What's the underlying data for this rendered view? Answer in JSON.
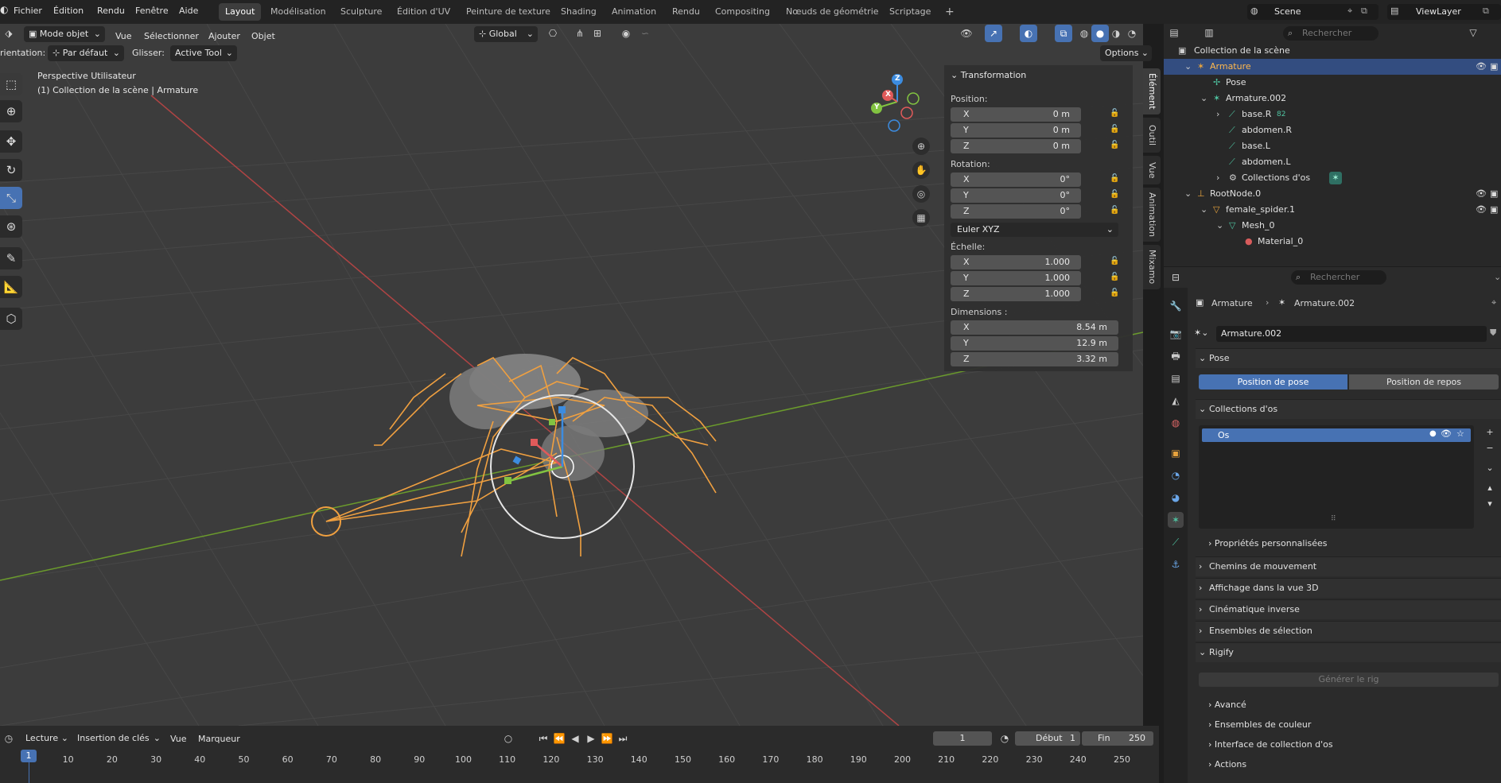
{
  "topbar": {
    "menus": [
      "Fichier",
      "Édition",
      "Rendu",
      "Fenêtre",
      "Aide"
    ],
    "workspaces": [
      "Layout",
      "Modélisation",
      "Sculpture",
      "Édition d'UV",
      "Peinture de texture",
      "Shading",
      "Animation",
      "Rendu",
      "Compositing",
      "Nœuds de géométrie",
      "Scriptage"
    ],
    "active_workspace": "Layout",
    "add_workspace": "+",
    "scene": "Scene",
    "view_layer": "ViewLayer"
  },
  "viewport_header": {
    "mode": "Mode objet",
    "menus": [
      "Vue",
      "Sélectionner",
      "Ajouter",
      "Objet"
    ],
    "transform_orientation": "Global",
    "options": "Options",
    "orientation_label": "rientation:",
    "orientation_value": "Par défaut",
    "drag_label": "Glisser:",
    "drag_value": "Active Tool"
  },
  "viewport": {
    "view_name": "Perspective Utilisateur",
    "collection_info": "(1) Collection de la scène | Armature",
    "gizmo": {
      "x": "X",
      "y": "Y",
      "z": "Z"
    }
  },
  "npanel": {
    "section": "Transformation",
    "position_label": "Position:",
    "position": [
      {
        "axis": "X",
        "value": "0 m"
      },
      {
        "axis": "Y",
        "value": "0 m"
      },
      {
        "axis": "Z",
        "value": "0 m"
      }
    ],
    "rotation_label": "Rotation:",
    "rotation": [
      {
        "axis": "X",
        "value": "0°"
      },
      {
        "axis": "Y",
        "value": "0°"
      },
      {
        "axis": "Z",
        "value": "0°"
      }
    ],
    "rotation_mode": "Euler XYZ",
    "scale_label": "Échelle:",
    "scale": [
      {
        "axis": "X",
        "value": "1.000"
      },
      {
        "axis": "Y",
        "value": "1.000"
      },
      {
        "axis": "Z",
        "value": "1.000"
      }
    ],
    "dimensions_label": "Dimensions :",
    "dimensions": [
      {
        "axis": "X",
        "value": "8.54 m"
      },
      {
        "axis": "Y",
        "value": "12.9 m"
      },
      {
        "axis": "Z",
        "value": "3.32 m"
      }
    ],
    "tabs": [
      "Élément",
      "Outil",
      "Vue",
      "Animation",
      "Mixamo"
    ]
  },
  "outliner": {
    "search_placeholder": "Rechercher",
    "root": "Collection de la scène",
    "items": [
      {
        "label": "Armature",
        "icon": "armature-icon",
        "color": "#e8a33d"
      },
      {
        "label": "Pose",
        "icon": "pose-icon",
        "color": "#4fc3a1"
      },
      {
        "label": "Armature.002",
        "icon": "armature-data-icon",
        "color": "#4fc3a1"
      },
      {
        "label": "base.R",
        "icon": "bone-icon",
        "color": "#4fc3a1",
        "badge": "82"
      },
      {
        "label": "abdomen.R",
        "icon": "bone-icon",
        "color": "#4fc3a1"
      },
      {
        "label": "base.L",
        "icon": "bone-icon",
        "color": "#4fc3a1"
      },
      {
        "label": "abdomen.L",
        "icon": "bone-icon",
        "color": "#4fc3a1"
      },
      {
        "label": "Collections d'os",
        "icon": "bone-collections-icon",
        "color": "#cfcfcf"
      },
      {
        "label": "RootNode.0",
        "icon": "empty-icon",
        "color": "#e8a33d"
      },
      {
        "label": "female_spider.1",
        "icon": "mesh-object-icon",
        "color": "#e8a33d"
      },
      {
        "label": "Mesh_0",
        "icon": "mesh-data-icon",
        "color": "#4fc3a1"
      },
      {
        "label": "Material_0",
        "icon": "material-icon",
        "color": "#d85c5c"
      }
    ]
  },
  "properties": {
    "search_placeholder": "Rechercher",
    "breadcrumb": [
      "Armature",
      "Armature.002"
    ],
    "datablock": "Armature.002",
    "pose_section": "Pose",
    "pose_position": "Position de pose",
    "rest_position": "Position de repos",
    "bone_collections_section": "Collections d'os",
    "bone_collection": "Os",
    "custom_props": "Propriétés personnalisées",
    "sections": [
      "Chemins de mouvement",
      "Affichage dans la vue 3D",
      "Cinématique inverse",
      "Ensembles de sélection"
    ],
    "rigify_section": "Rigify",
    "generate_rig": "Générer le rig",
    "rigify_subs": [
      "Avancé",
      "Ensembles de couleur",
      "Interface de collection d'os",
      "Actions"
    ]
  },
  "timeline": {
    "menus": [
      "Lecture",
      "Insertion de clés",
      "Vue",
      "Marqueur"
    ],
    "current_frame": "1",
    "start_label": "Début",
    "start": "1",
    "end_label": "Fin",
    "end": "250",
    "ticks": [
      "1",
      "10",
      "20",
      "30",
      "40",
      "50",
      "60",
      "70",
      "80",
      "90",
      "100",
      "110",
      "120",
      "130",
      "140",
      "150",
      "160",
      "170",
      "180",
      "190",
      "200",
      "210",
      "220",
      "230",
      "240",
      "250"
    ]
  },
  "colors": {
    "accent": "#4772b3",
    "selection": "#e8a33d",
    "x_axis": "#e05a5a",
    "y_axis": "#82c341",
    "z_axis": "#3c8ce0"
  }
}
